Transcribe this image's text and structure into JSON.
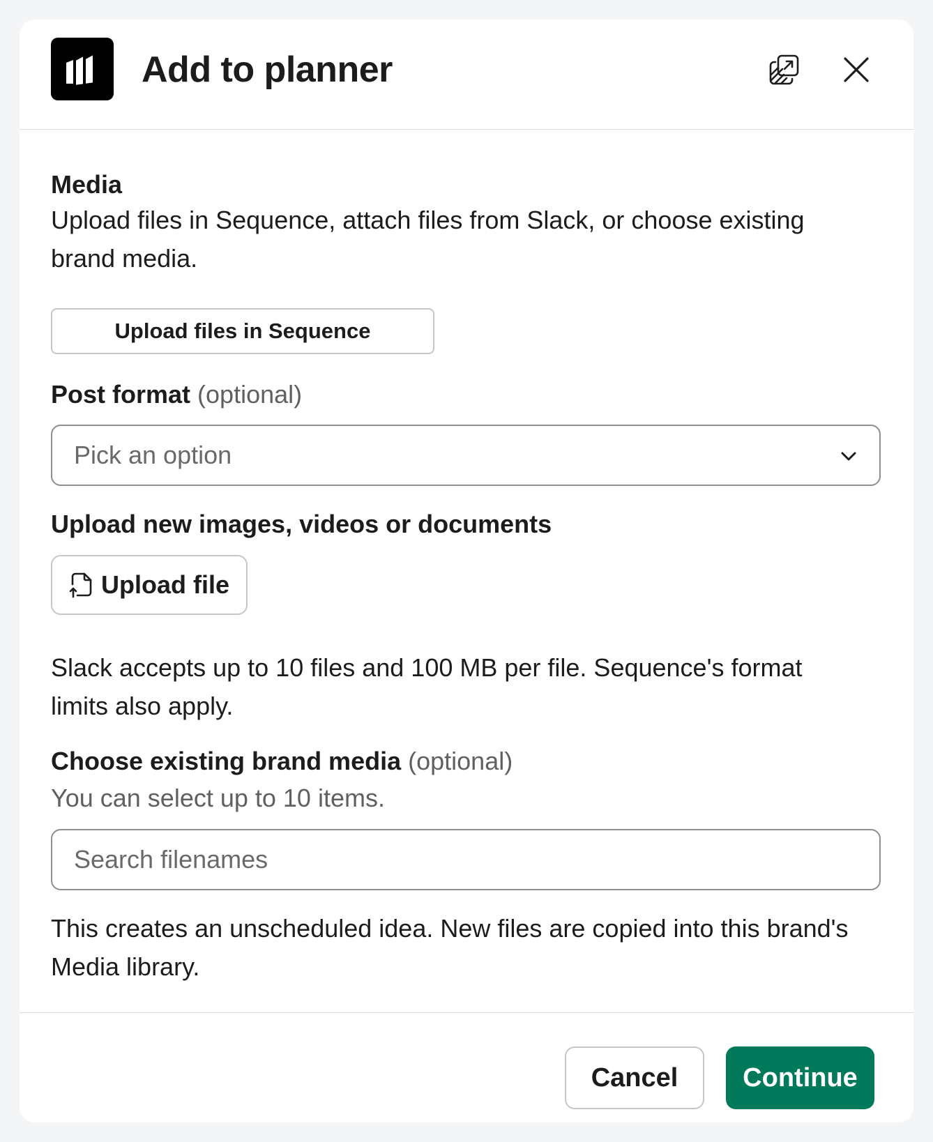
{
  "header": {
    "title": "Add to planner",
    "logo_icon": "sequence-bars-logo",
    "popout_icon": "popout-window-icon",
    "close_icon": "close-icon"
  },
  "media": {
    "label": "Media",
    "description": "Upload files in Sequence, attach files from Slack, or choose existing brand media.",
    "upload_in_sequence_label": "Upload files in Sequence"
  },
  "post_format": {
    "label": "Post format",
    "optional": "(optional)",
    "placeholder": "Pick an option"
  },
  "upload_new": {
    "label": "Upload new images, videos or documents",
    "button_label": "Upload file",
    "limits_text": "Slack accepts up to 10 files and 100 MB per file. Sequence's format limits also apply."
  },
  "brand_media": {
    "label": "Choose existing brand media",
    "optional": "(optional)",
    "hint": "You can select up to 10 items.",
    "search_placeholder": "Search filenames"
  },
  "footnote": "This creates an unscheduled idea. New files are copied into this brand's Media library.",
  "footer": {
    "cancel_label": "Cancel",
    "continue_label": "Continue"
  },
  "colors": {
    "primary": "#007a5a",
    "text": "#1d1c1d",
    "muted": "#616061"
  }
}
